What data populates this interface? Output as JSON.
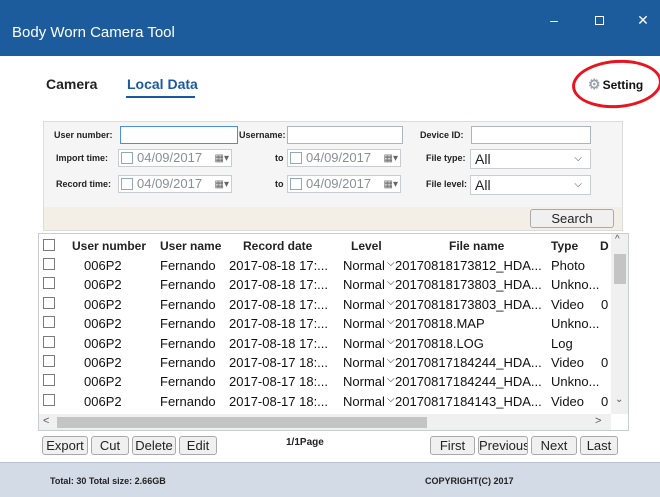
{
  "window": {
    "title": "Body Worn Camera Tool",
    "min_glyph": "–",
    "close_glyph": "✕"
  },
  "tabs": [
    {
      "label": "Camera"
    },
    {
      "label": "Local Data"
    }
  ],
  "setting": {
    "label": "Setting",
    "icon": "gear-icon",
    "glyph": "⚙"
  },
  "filters": {
    "user_number_label": "User number:",
    "user_number_value": "",
    "username_label": "Username:",
    "username_value": "",
    "device_id_label": "Device ID:",
    "device_id_value": "",
    "import_time_label": "Import time:",
    "import_from": "04/09/2017",
    "to_label": "to",
    "import_to": "04/09/2017",
    "file_type_label": "File type:",
    "file_type_value": "All",
    "record_time_label": "Record time:",
    "record_from": "04/09/2017",
    "record_to": "04/09/2017",
    "file_level_label": "File level:",
    "file_level_value": "All",
    "calendar_glyph": "▦▾",
    "dropdown_glyph": "⌵",
    "search_label": "Search"
  },
  "table": {
    "columns": [
      "User number",
      "User name",
      "Record date",
      "Level",
      "File name",
      "Type",
      "D"
    ],
    "level_glyph": "⌵",
    "rows": [
      {
        "user_number": "006P2",
        "user_name": "Fernando",
        "record_date": "2017-08-18 17:...",
        "level": "Normal",
        "level_arrow": true,
        "file_name": "20170818173812_HDA...",
        "type": "Photo",
        "extra": ""
      },
      {
        "user_number": "006P2",
        "user_name": "Fernando",
        "record_date": "2017-08-18 17:...",
        "level": "Normal",
        "level_arrow": true,
        "file_name": "20170818173803_HDA...",
        "type": "Unkno...",
        "extra": ""
      },
      {
        "user_number": "006P2",
        "user_name": "Fernando",
        "record_date": "2017-08-18 17:...",
        "level": "Normal",
        "level_arrow": true,
        "file_name": "20170818173803_HDA...",
        "type": "Video",
        "extra": "0"
      },
      {
        "user_number": "006P2",
        "user_name": "Fernando",
        "record_date": "2017-08-18 17:...",
        "level": "Normal",
        "level_arrow": true,
        "file_name": "20170818.MAP",
        "type": "Unkno...",
        "extra": ""
      },
      {
        "user_number": "006P2",
        "user_name": "Fernando",
        "record_date": "2017-08-18 17:...",
        "level": "Normal",
        "level_arrow": true,
        "file_name": "20170818.LOG",
        "type": "Log",
        "extra": ""
      },
      {
        "user_number": "006P2",
        "user_name": "Fernando",
        "record_date": "2017-08-17 18:...",
        "level": "Normal",
        "level_arrow": true,
        "file_name": "20170817184244_HDA...",
        "type": "Video",
        "extra": "0"
      },
      {
        "user_number": "006P2",
        "user_name": "Fernando",
        "record_date": "2017-08-17 18:...",
        "level": "Normal",
        "level_arrow": true,
        "file_name": "20170817184244_HDA...",
        "type": "Unkno...",
        "extra": ""
      },
      {
        "user_number": "006P2",
        "user_name": "Fernando",
        "record_date": "2017-08-17 18:...",
        "level": "Normal",
        "level_arrow": true,
        "file_name": "20170817184143_HDA...",
        "type": "Video",
        "extra": "0"
      }
    ],
    "scroll_glyphs": {
      "up": "^",
      "down": "⌄",
      "left": "<",
      "right": ">"
    }
  },
  "pagination": {
    "export_label": "Export",
    "cut_label": "Cut",
    "delete_label": "Delete",
    "edit_label": "Edit",
    "page_info": "1/1Page",
    "first_label": "First",
    "previous_label": "Previous",
    "next_label": "Next",
    "last_label": "Last"
  },
  "footer": {
    "total": "Total: 30 Total size: 2.66GB",
    "copyright": "COPYRIGHT(C) 2017"
  },
  "colors": {
    "titlebar": "#1d5c9c",
    "tab_active": "#1a5aa3",
    "highlight_circle": "#e8141f",
    "footer": "#d3dbe6"
  }
}
